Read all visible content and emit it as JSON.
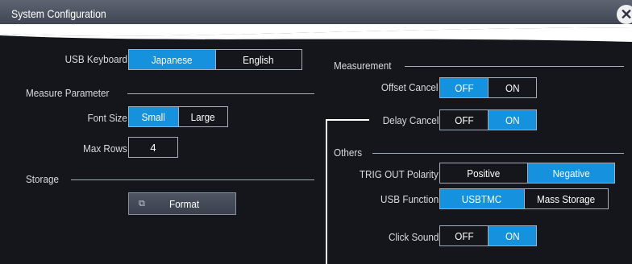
{
  "window": {
    "title": "System Configuration",
    "close_icon": "close-icon"
  },
  "left": {
    "usb_keyboard": {
      "label": "USB Keyboard",
      "options": [
        "Japanese",
        "English"
      ],
      "selected": "Japanese"
    },
    "measure_parameter": {
      "heading": "Measure Parameter",
      "font_size": {
        "label": "Font Size",
        "options": [
          "Small",
          "Large"
        ],
        "selected": "Small"
      },
      "max_rows": {
        "label": "Max Rows",
        "value": "4"
      }
    },
    "storage": {
      "heading": "Storage",
      "format_label": "Format",
      "format_icon": "export-icon"
    }
  },
  "right": {
    "measurement": {
      "heading": "Measurement",
      "offset_cancel": {
        "label": "Offset Cancel",
        "options": [
          "OFF",
          "ON"
        ],
        "selected": "OFF"
      },
      "delay_cancel": {
        "label": "Delay Cancel",
        "options": [
          "OFF",
          "ON"
        ],
        "selected": "ON"
      }
    },
    "others": {
      "heading": "Others",
      "trig_out_polarity": {
        "label": "TRIG OUT Polarity",
        "options": [
          "Positive",
          "Negative"
        ],
        "selected": "Negative"
      },
      "usb_function": {
        "label": "USB Function",
        "options": [
          "USBTMC",
          "Mass Storage"
        ],
        "selected": "USBTMC"
      },
      "click_sound": {
        "label": "Click Sound",
        "options": [
          "OFF",
          "ON"
        ],
        "selected": "ON"
      }
    }
  },
  "colors": {
    "background": "#14161c",
    "accent": "#1591de",
    "titlebar": "#4d5360"
  }
}
